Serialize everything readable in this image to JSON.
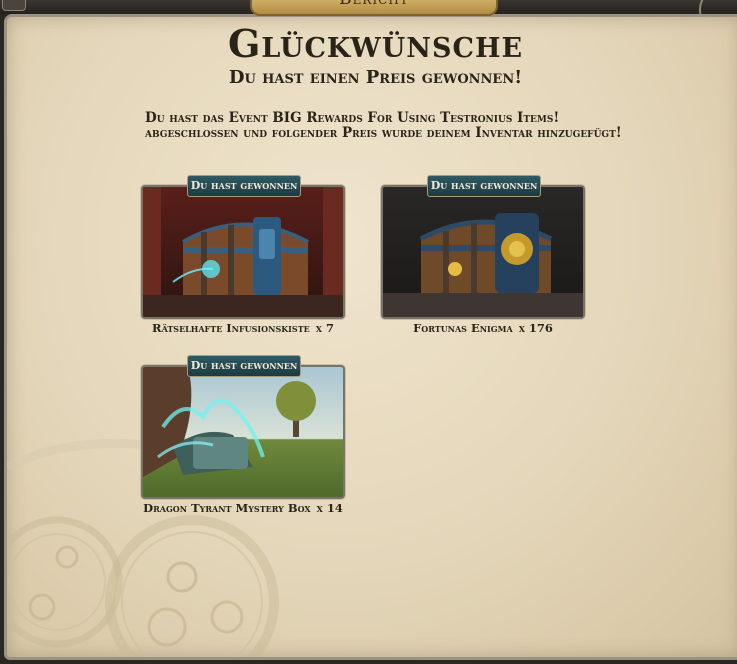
{
  "header": {
    "tab_label": "Bericht"
  },
  "dialog": {
    "title": "Glückwünsche",
    "subtitle": "Du hast einen Preis gewonnen!",
    "message": "Du hast das Event BIG Rewards For Using Testronius Items! abgeschlossen und folgender Preis wurde deinem Inventar hinzugefügt!"
  },
  "prizes": [
    {
      "banner": "Du hast gewonnen",
      "name": "Rätselhafte Infusionskiste",
      "quantity": "x 7",
      "image": "infusion-chest-image"
    },
    {
      "banner": "Du hast gewonnen",
      "name": "Fortunas Enigma",
      "quantity": "x 176",
      "image": "fortunas-enigma-chest-image"
    },
    {
      "banner": "Du hast gewonnen",
      "name": "Dragon Tyrant Mystery Box",
      "quantity": "x 14",
      "image": "dragon-tyrant-box-image"
    }
  ],
  "colors": {
    "parchment": "#e4d6b9",
    "text": "#2a2418",
    "banner": "#1c3b42",
    "header_gold": "#c2a054"
  }
}
